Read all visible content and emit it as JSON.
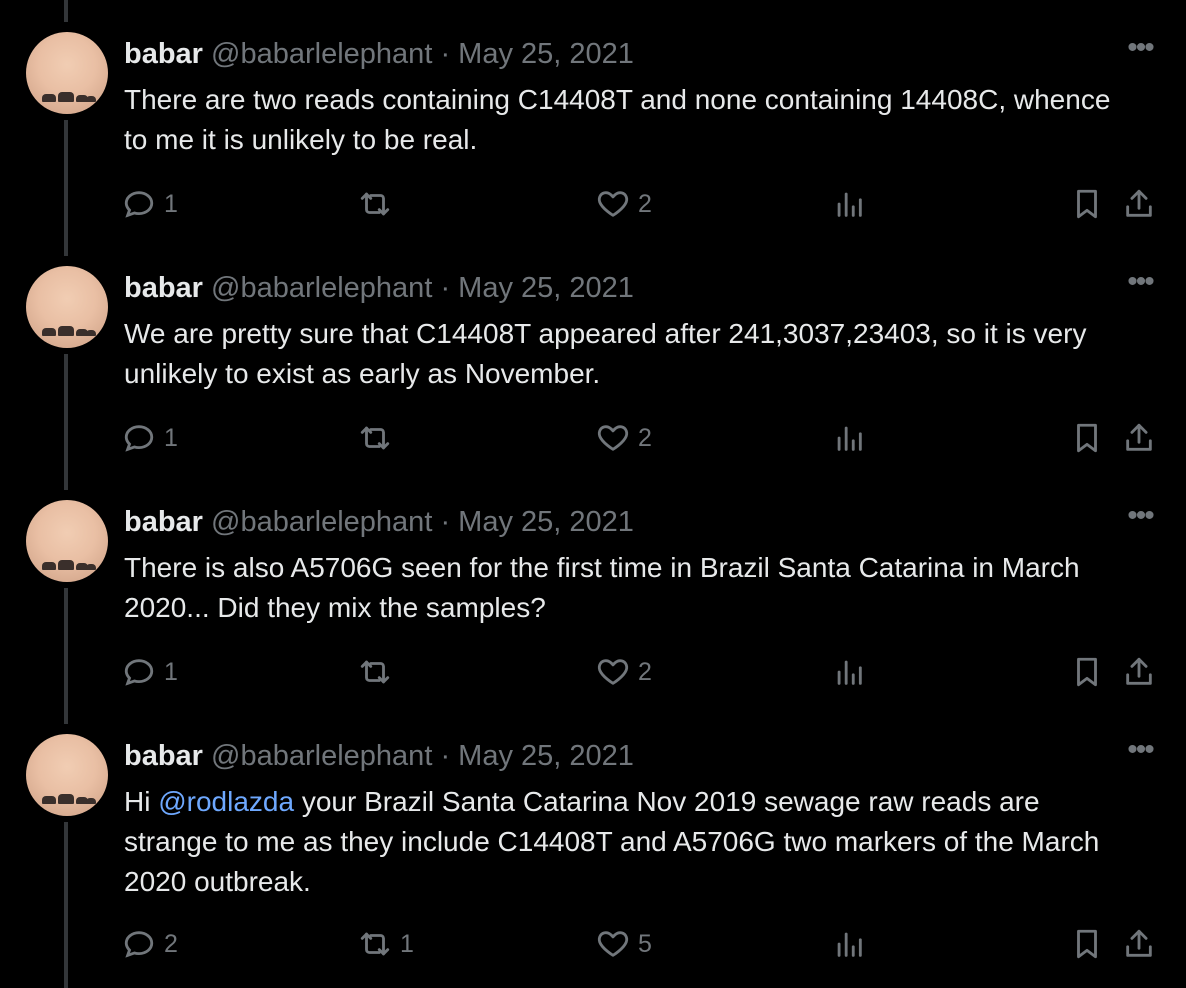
{
  "tweets": [
    {
      "name": "babar",
      "handle": "@babarlelephant",
      "sep": "·",
      "date": "May 25, 2021",
      "text_parts": {
        "pre": "There are two reads containing C14408T and none containing 14408C, whence to me it is unlikely to be real.",
        "mention": "",
        "post": ""
      },
      "counts": {
        "replies": "1",
        "retweets": "",
        "likes": "2"
      }
    },
    {
      "name": "babar",
      "handle": "@babarlelephant",
      "sep": "·",
      "date": "May 25, 2021",
      "text_parts": {
        "pre": "We are pretty sure that C14408T appeared after 241,3037,23403, so it is very unlikely to exist as early as November.",
        "mention": "",
        "post": ""
      },
      "counts": {
        "replies": "1",
        "retweets": "",
        "likes": "2"
      }
    },
    {
      "name": "babar",
      "handle": "@babarlelephant",
      "sep": "·",
      "date": "May 25, 2021",
      "text_parts": {
        "pre": "There is also A5706G seen for the first time in Brazil Santa Catarina in March 2020... Did they mix the samples?",
        "mention": "",
        "post": ""
      },
      "counts": {
        "replies": "1",
        "retweets": "",
        "likes": "2"
      }
    },
    {
      "name": "babar",
      "handle": "@babarlelephant",
      "sep": "·",
      "date": "May 25, 2021",
      "text_parts": {
        "pre": "Hi ",
        "mention": "@rodlazda",
        "post": " your Brazil Santa Catarina Nov 2019 sewage raw reads are strange to me as they include C14408T and A5706G two markers of the March 2020 outbreak."
      },
      "counts": {
        "replies": "2",
        "retweets": "1",
        "likes": "5"
      }
    }
  ],
  "icons": {
    "reply": "reply-icon",
    "retweet": "retweet-icon",
    "like": "heart-icon",
    "views": "views-icon",
    "bookmark": "bookmark-icon",
    "share": "share-icon",
    "more": "more-icon"
  },
  "colors": {
    "background": "#000000",
    "text": "#e7e9ea",
    "muted": "#71767b",
    "mention": "#6ea8fe",
    "thread_line": "#333639"
  }
}
